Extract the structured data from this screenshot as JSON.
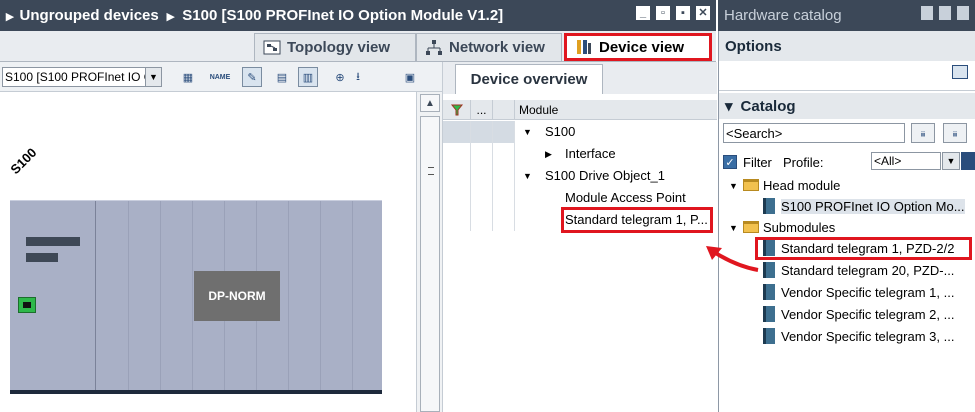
{
  "window": {
    "title_prefix": "Ungrouped devices",
    "title_device": "S100 [S100 PROFInet IO Option Module V1.2]"
  },
  "catalog_window": {
    "title": "Hardware catalog"
  },
  "view_tabs": [
    {
      "label": "Topology view",
      "icon": "topology-icon"
    },
    {
      "label": "Network view",
      "icon": "network-icon"
    },
    {
      "label": "Device view",
      "icon": "device-icon",
      "active": true
    }
  ],
  "toolbar": {
    "device_select": "S100 [S100 PROFInet IO Optio"
  },
  "canvas": {
    "device_label": "S100",
    "module_label": "DP-NORM"
  },
  "device_overview": {
    "tab_label": "Device overview",
    "header_dots": "...",
    "header_module": "Module",
    "rows": [
      {
        "label": "S100",
        "expanded": true
      },
      {
        "label": "Interface",
        "expanded": false
      },
      {
        "label": "S100 Drive Object_1",
        "expanded": true
      },
      {
        "label": "Module Access Point"
      },
      {
        "label": "Standard telegram 1, P..."
      }
    ]
  },
  "catalog": {
    "options_label": "Options",
    "catalog_label": "Catalog",
    "search_placeholder": "<Search>",
    "filter_label": "Filter",
    "profile_label": "Profile:",
    "profile_value": "<All>",
    "tree": [
      {
        "label": "Head module",
        "kind": "folder"
      },
      {
        "label": "S100 PROFInet IO Option Mo...",
        "kind": "module"
      },
      {
        "label": "Submodules",
        "kind": "folder"
      },
      {
        "label": "Standard telegram 1, PZD-2/2",
        "kind": "module"
      },
      {
        "label": "Standard telegram 20, PZD-...",
        "kind": "module"
      },
      {
        "label": "Vendor Specific telegram 1, ...",
        "kind": "module"
      },
      {
        "label": "Vendor Specific telegram 2, ...",
        "kind": "module"
      },
      {
        "label": "Vendor Specific telegram 3, ...",
        "kind": "module"
      }
    ]
  },
  "colors": {
    "titlebar": "#3c4858",
    "highlight_red": "#e0161f",
    "rack": "#a9b0c6"
  }
}
